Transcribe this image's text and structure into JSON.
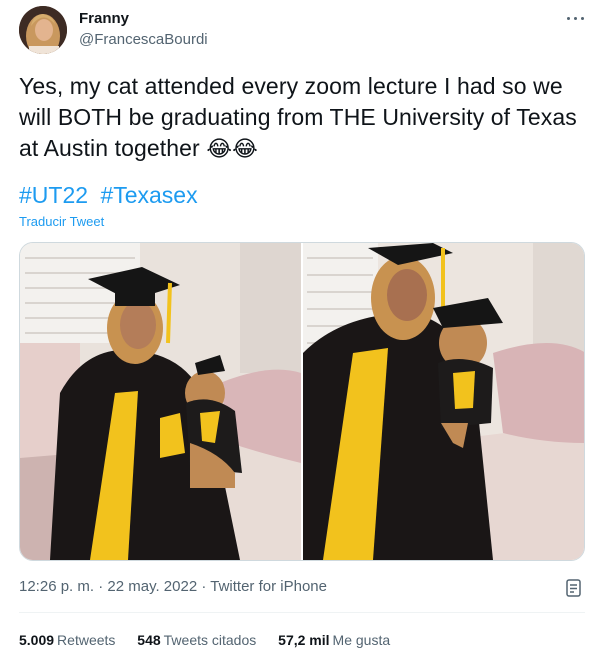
{
  "author": {
    "name": "Franny",
    "handle": "@FrancescaBourdi"
  },
  "tweet": {
    "text": "Yes, my cat attended every zoom lecture I had so we will BOTH be graduating from THE University of Texas at Austin together",
    "emojis": "😂😂",
    "hashtags": [
      "#UT22",
      "#Texasex"
    ],
    "translate_label": "Traducir Tweet"
  },
  "meta": {
    "time": "12:26 p. m.",
    "separator": "·",
    "date": "22 may. 2022",
    "source": "Twitter for iPhone"
  },
  "stats": {
    "retweets_count": "5.009",
    "retweets_label": "Retweets",
    "quotes_count": "548",
    "quotes_label": "Tweets citados",
    "likes_count": "57,2 mil",
    "likes_label": "Me gusta"
  },
  "icons": {
    "more": "more-horizontal-icon",
    "analytics": "analytics-icon"
  },
  "colors": {
    "link": "#1d9bf0",
    "secondary_text": "#536471",
    "primary_text": "#0f1419"
  }
}
